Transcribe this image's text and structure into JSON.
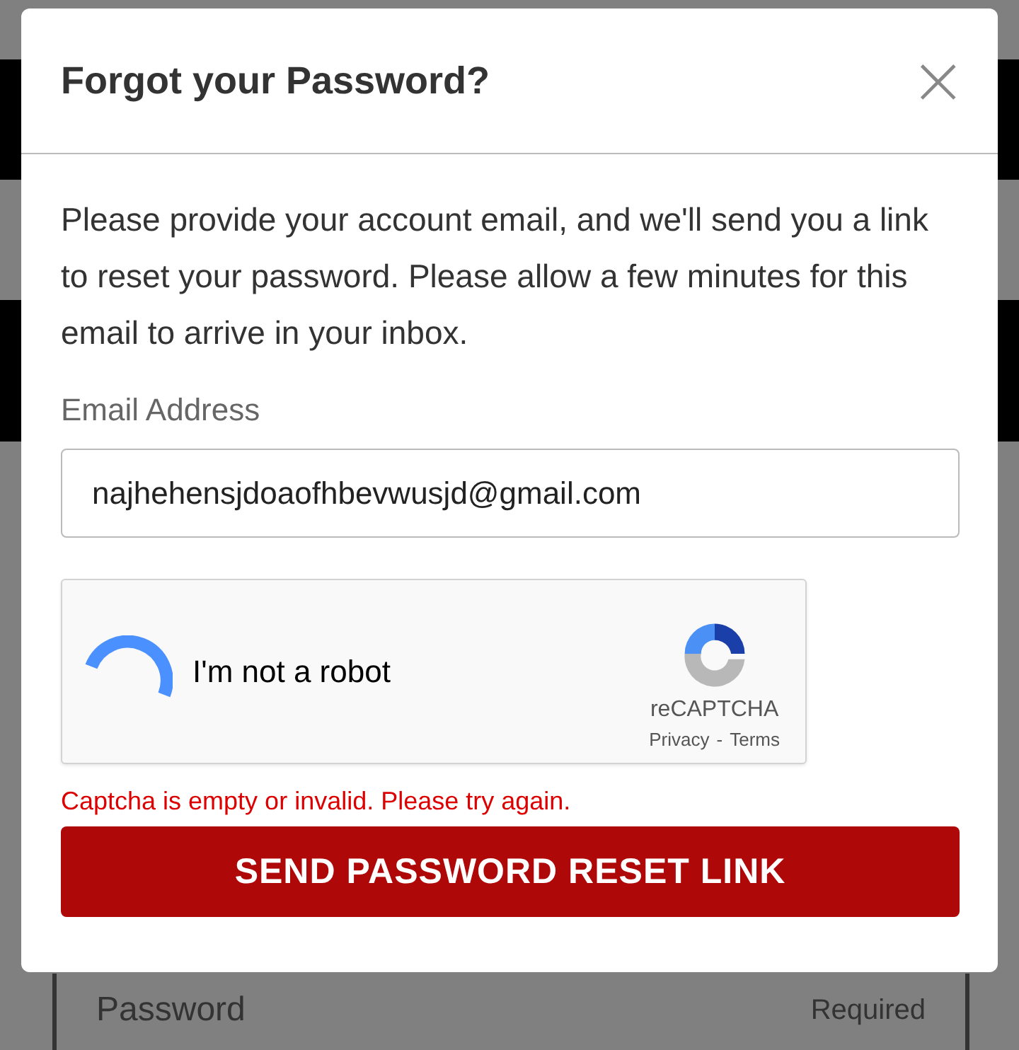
{
  "background": {
    "password_field": {
      "label": "Password",
      "hint": "Required"
    }
  },
  "dialog": {
    "title": "Forgot your Password?",
    "close": "×",
    "message": "Please provide your account email, and we'll send you a link to reset your password. Please allow a few minutes for this email to arrive in your inbox.",
    "email": {
      "label": "Email Address",
      "value": "najhehensjdoaofhbevwusjd@gmail.com"
    },
    "captcha": {
      "label": "I'm not a robot",
      "brand": "reCAPTCHA",
      "links": [
        "Privacy",
        "Terms"
      ],
      "separator": "-"
    },
    "error": "Captcha is empty or invalid. Please try again.",
    "submit": "SEND PASSWORD RESET LINK"
  }
}
